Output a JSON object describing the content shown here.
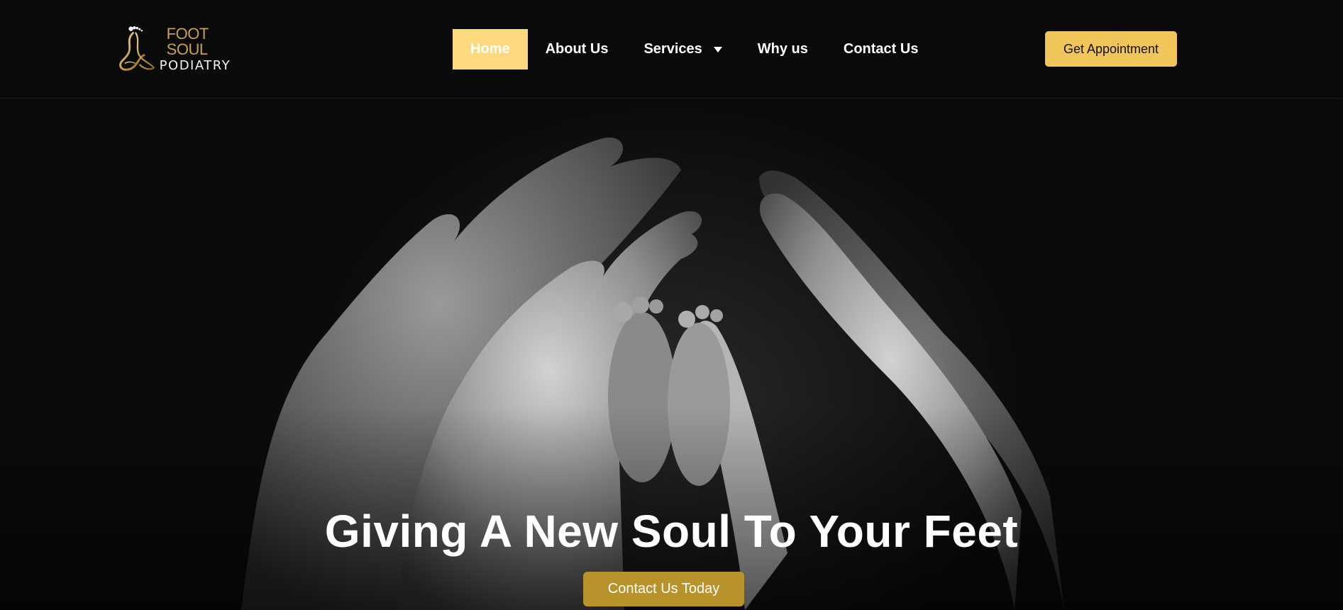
{
  "brand": {
    "line1": "FOOT SOUL",
    "line2": "PODIATRY",
    "accent_color": "#c8a14b"
  },
  "nav": {
    "items": [
      {
        "label": "Home",
        "active": true
      },
      {
        "label": "About Us"
      },
      {
        "label": "Services",
        "has_dropdown": true
      },
      {
        "label": "Why us"
      },
      {
        "label": "Contact Us"
      }
    ],
    "active_color": "#fbd97c"
  },
  "header": {
    "cta_label": "Get Appointment",
    "cta_color": "#f0c65a"
  },
  "hero": {
    "title": "Giving A New Soul To Your Feet",
    "button_label": "Contact Us Today",
    "button_color": "#b8922a",
    "image_subject": "hands-cradling-baby-feet-photo"
  },
  "icons": {
    "logo": "foot-soul-logo-icon",
    "dropdown": "chevron-down-icon"
  }
}
